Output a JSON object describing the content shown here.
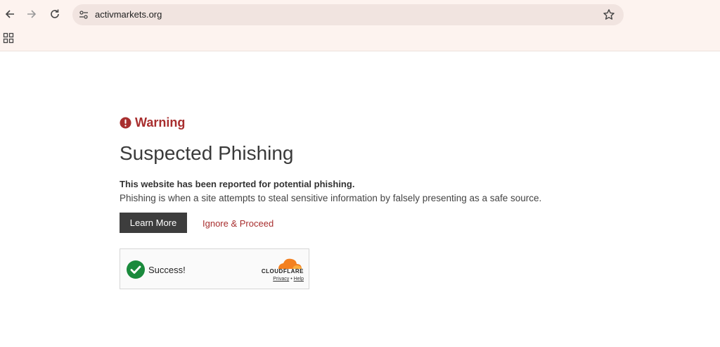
{
  "browser": {
    "url": "activmarkets.org",
    "icons": {
      "back": "arrow-left-icon",
      "forward": "arrow-right-icon",
      "reload": "reload-icon",
      "site_info": "tune-icon",
      "bookmark": "star-icon",
      "apps": "apps-grid-icon"
    }
  },
  "page": {
    "warning_label": "Warning",
    "title": "Suspected Phishing",
    "lead": "This website has been reported for potential phishing.",
    "description": "Phishing is when a site attempts to steal sensitive information by falsely presenting as a safe source.",
    "learn_more_label": "Learn More",
    "ignore_label": "Ignore & Proceed"
  },
  "captcha": {
    "status": "Success!",
    "provider": "CLOUDFLARE",
    "privacy": "Privacy",
    "separator": "•",
    "help": "Help"
  },
  "colors": {
    "accent_red": "#a82e2e",
    "success_green": "#1a8a3c",
    "cloudflare_orange": "#f38020",
    "button_dark": "#3d3d3d",
    "chrome_bg": "#fdf3ef"
  }
}
